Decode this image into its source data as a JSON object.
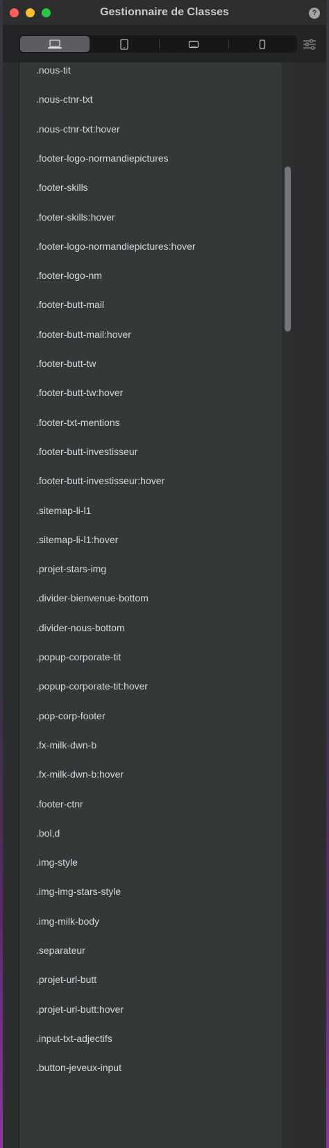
{
  "window": {
    "title": "Gestionnaire de Classes",
    "help_label": "?"
  },
  "devices": [
    {
      "name": "desktop",
      "icon": "laptop-icon",
      "active": true
    },
    {
      "name": "tablet-portrait",
      "icon": "tablet-icon",
      "active": false
    },
    {
      "name": "tablet-landscape",
      "icon": "tablet-landscape-icon",
      "active": false
    },
    {
      "name": "phone",
      "icon": "phone-icon",
      "active": false
    }
  ],
  "filter_icon": "sliders-icon",
  "classes": [
    ".nous-tit",
    ".nous-ctnr-txt",
    ".nous-ctnr-txt:hover",
    ".footer-logo-normandiepictures",
    ".footer-skills",
    ".footer-skills:hover",
    ".footer-logo-normandiepictures:hover",
    ".footer-logo-nm",
    ".footer-butt-mail",
    ".footer-butt-mail:hover",
    ".footer-butt-tw",
    ".footer-butt-tw:hover",
    ".footer-txt-mentions",
    ".footer-butt-investisseur",
    ".footer-butt-investisseur:hover",
    ".sitemap-li-l1",
    ".sitemap-li-l1:hover",
    ".projet-stars-img",
    ".divider-bienvenue-bottom",
    ".divider-nous-bottom",
    ".popup-corporate-tit",
    ".popup-corporate-tit:hover",
    ".pop-corp-footer",
    ".fx-milk-dwn-b",
    ".fx-milk-dwn-b:hover",
    ".footer-ctnr",
    ".bol,d",
    ".img-style",
    ".img-img-stars-style",
    ".img-milk-body",
    ".separateur",
    ".projet-url-butt",
    ".projet-url-butt:hover",
    ".input-txt-adjectifs",
    ".button-jeveux-input"
  ],
  "colors": {
    "close": "#fe5f57",
    "minimize": "#febc2e",
    "maximize": "#28c840",
    "list_background": "#353839",
    "text": "#d6d8da"
  }
}
